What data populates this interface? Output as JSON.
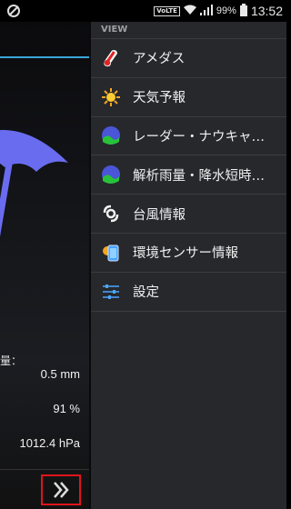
{
  "status_bar": {
    "network_label": "VoLTE",
    "battery_percent": "99%",
    "time": "13:52"
  },
  "app": {
    "label_fragment": "量：",
    "precipitation": "0.5 mm",
    "humidity": "91 %",
    "pressure": "1012.4 hPa",
    "accent_color": "#3aa8d8"
  },
  "drawer": {
    "header": "VIEW",
    "items": [
      {
        "label": "アメダス",
        "icon": "thermometer-icon"
      },
      {
        "label": "天気予報",
        "icon": "sun-icon"
      },
      {
        "label": "レーダー・ナウキャ…",
        "icon": "radar-globe-icon"
      },
      {
        "label": "解析雨量・降水短時…",
        "icon": "rain-globe-icon"
      },
      {
        "label": "台風情報",
        "icon": "typhoon-icon"
      },
      {
        "label": "環境センサー情報",
        "icon": "sensor-phone-icon"
      },
      {
        "label": "設定",
        "icon": "settings-sliders-icon"
      }
    ]
  }
}
